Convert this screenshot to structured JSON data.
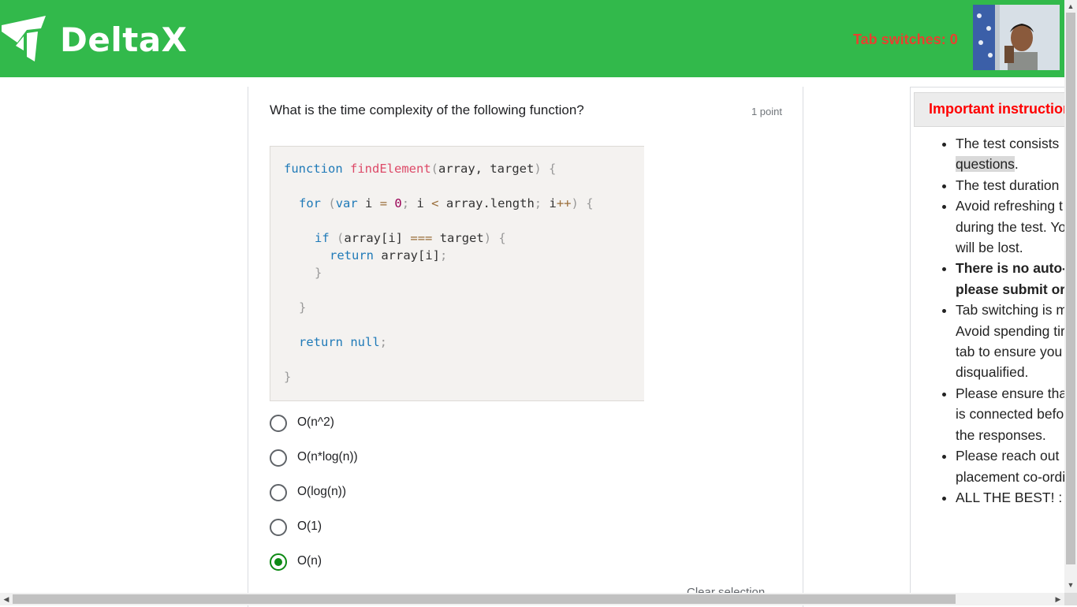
{
  "header": {
    "brand": "DeltaX",
    "tab_switches": "Tab switches: 0",
    "colors": {
      "bar": "#32b94b",
      "warning": "#e8412f"
    },
    "webcam_icon": "webcam-feed"
  },
  "question": {
    "text": "What is the time complexity of the following function?",
    "points": "1 point",
    "code": {
      "line1_kw": "function",
      "line1_fn": "findElement",
      "line1_rest": "array, target",
      "for_kw": "for",
      "var_kw": "var",
      "for_i": "i",
      "zero": "0",
      "cond": "i",
      "length": "array.length",
      "incr": "i",
      "if_kw": "if",
      "if_lhs": "array[i]",
      "strict": "===",
      "if_rhs": "target",
      "return_kw": "return",
      "return_val": "array[i]",
      "return2_kw": "return",
      "null_kw": "null"
    },
    "options": [
      {
        "label": "O(n^2)",
        "selected": false
      },
      {
        "label": "O(n*log(n))",
        "selected": false
      },
      {
        "label": "O(log(n))",
        "selected": false
      },
      {
        "label": "O(1)",
        "selected": false
      },
      {
        "label": "O(n)",
        "selected": true
      }
    ],
    "clear_selection": "Clear selection"
  },
  "instructions": {
    "title": "Important instructions",
    "items": {
      "i1a": "The test consists",
      "i1b": "questions",
      "i1c": ".",
      "i2": "The test duration",
      "i3a": "Avoid refreshing t",
      "i3b": "during the test. Yo",
      "i3c": "will be lost.",
      "i4a": "There is no auto-",
      "i4b": "please submit or",
      "i5a": "Tab switching is m",
      "i5b": "Avoid spending tir",
      "i5c": "tab to ensure you",
      "i5d": "disqualified.",
      "i6a": "Please ensure tha",
      "i6b": "is connected befo",
      "i6c": "the responses.",
      "i7a": "Please reach out",
      "i7b": "placement co-ordi",
      "i8": "ALL THE BEST! :"
    }
  }
}
